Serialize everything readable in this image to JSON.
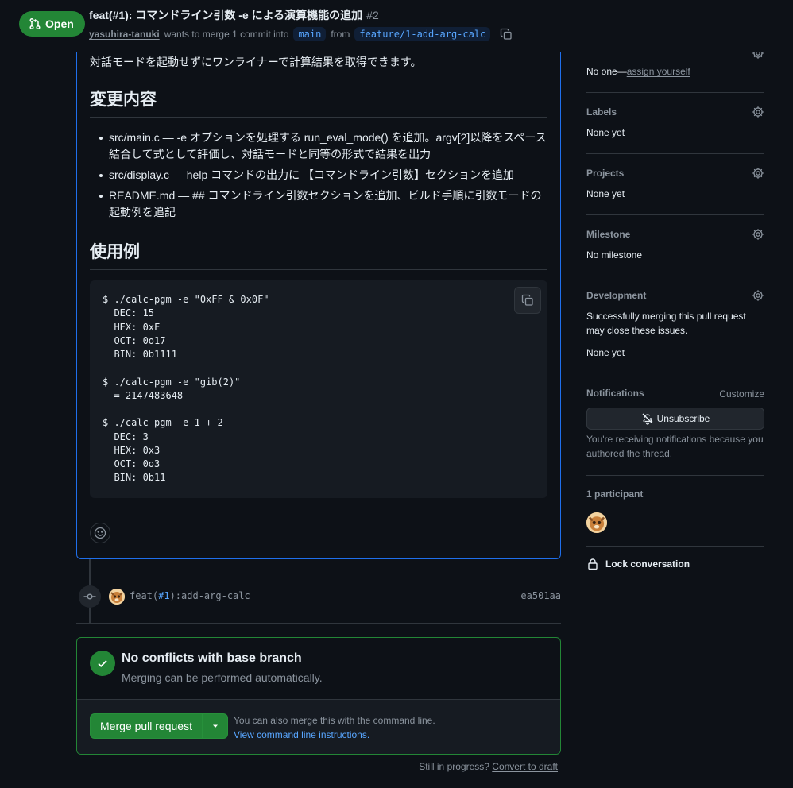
{
  "header": {
    "state_label": "Open",
    "title": "feat(#1): コマンドライン引数 -e による演算機能の追加",
    "number": "#2",
    "author": "yasuhira-tanuki",
    "merge_text": "wants to merge 1 commit into",
    "base_branch": "main",
    "from_text": "from",
    "head_branch": "feature/1-add-arg-calc"
  },
  "description": {
    "lead": "対話モードを起動せずにワンライナーで計算結果を取得できます。",
    "heading_changes": "変更内容",
    "changes": [
      "src/main.c — -e オプションを処理する run_eval_mode() を追加。argv[2]以降をスペース結合して式として評価し、対話モードと同等の形式で結果を出力",
      "src/display.c — help コマンドの出力に 【コマンドライン引数】セクションを追加",
      "README.md — ## コマンドライン引数セクションを追加、ビルド手順に引数モードの起動例を追記"
    ],
    "heading_usage": "使用例",
    "code": "$ ./calc-pgm -e \"0xFF & 0x0F\"\n  DEC: 15\n  HEX: 0xF\n  OCT: 0o17\n  BIN: 0b1111\n\n$ ./calc-pgm -e \"gib(2)\"\n  = 2147483648\n\n$ ./calc-pgm -e 1 + 2\n  DEC: 3\n  HEX: 0x3\n  OCT: 0o3\n  BIN: 0b11"
  },
  "timeline": {
    "commit_prefix": "feat(",
    "commit_ref": "#1",
    "commit_suffix": "):add-arg-calc",
    "sha": "ea501aa"
  },
  "merge": {
    "title": "No conflicts with base branch",
    "subtitle": "Merging can be performed automatically.",
    "button": "Merge pull request",
    "note": "You can also merge this with the command line.",
    "link": "View command line instructions.",
    "draft_text": "Still in progress?",
    "draft_link": "Convert to draft"
  },
  "sidebar": {
    "assignees_value": "No one—",
    "assign_link": "assign yourself",
    "labels_title": "Labels",
    "labels_value": "None yet",
    "projects_title": "Projects",
    "projects_value": "None yet",
    "milestone_title": "Milestone",
    "milestone_value": "No milestone",
    "development_title": "Development",
    "development_text": "Successfully merging this pull request may close these issues.",
    "development_value": "None yet",
    "notifications_title": "Notifications",
    "customize": "Customize",
    "unsubscribe": "Unsubscribe",
    "notify_reason": "You're receiving notifications because you authored the thread.",
    "participants": "1 participant",
    "lock": "Lock conversation"
  },
  "colors": {
    "accent_green": "#238636",
    "link_blue": "#58a6ff",
    "background": "#0d1117"
  }
}
